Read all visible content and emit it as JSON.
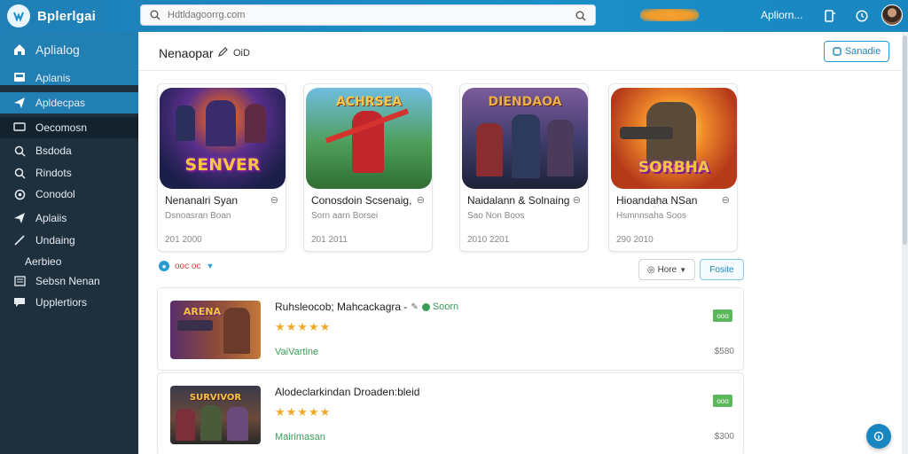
{
  "brand": {
    "name": "Bplerlgai"
  },
  "search": {
    "placeholder": "Hdtldagoorrg.com",
    "value": ""
  },
  "topbar": {
    "user_label": "Apliorn...",
    "colors": {
      "bar": "#1b8fc9",
      "accent": "#f09a2a"
    }
  },
  "sidebar": {
    "items": [
      {
        "label": "Aplialog",
        "icon": "home-icon"
      },
      {
        "label": "Aplanis",
        "icon": "inbox-icon"
      },
      {
        "label": "Apldecpas",
        "icon": "send-icon"
      },
      {
        "label": "Oecomosn",
        "icon": "chat-icon"
      },
      {
        "label": "Bsdoda",
        "icon": "search-icon"
      },
      {
        "label": "Rindots",
        "icon": "search-icon"
      },
      {
        "label": "Conodol",
        "icon": "settings-icon"
      },
      {
        "label": "Aplaiis",
        "icon": "send-icon"
      },
      {
        "label": "Undaing",
        "icon": "pen-icon"
      },
      {
        "label": "Aerbieo",
        "icon": ""
      },
      {
        "label": "Sebsn Nenan",
        "icon": "list-icon"
      },
      {
        "label": "Upplertiors",
        "icon": "comment-icon"
      }
    ]
  },
  "header": {
    "title": "Nenaopar",
    "subtitle": "OiD",
    "button_label": "Sanadie"
  },
  "cards": [
    {
      "title": "Nenanalri Syan",
      "subtitle": "Dsnoasran Boan",
      "meta": "201 2000",
      "art_text": "SENVER"
    },
    {
      "title": "Conosdoin Scsenaig,",
      "subtitle": "Sorn aarn Borsei",
      "meta": "201 2011",
      "art_text": "ACHRSEA"
    },
    {
      "title": "Naidalann & Solnaing",
      "subtitle": "Sao Non Boos",
      "meta": "2010 2201",
      "art_text": "DIENDAOA"
    },
    {
      "title": "Hioandaha NSan",
      "subtitle": "Hsmnnsaha Soos",
      "meta": "290 2010",
      "art_text": "SORBHA"
    }
  ],
  "filter": {
    "label": "ooc oc",
    "sort_label": "Hore",
    "filter_label": "Fosite"
  },
  "list": [
    {
      "title": "Ruhsleocob; Mahcackagra -",
      "badge": "Soorn",
      "rating": "★★★★★",
      "tag": "VaiVartine",
      "chip": "ooo",
      "price": "$580",
      "art_text": "ARENA"
    },
    {
      "title": "Alodeclarkindan Droaden:bleid",
      "badge": "",
      "rating": "★★★★★",
      "tag": "Mairimasan",
      "chip": "ooo",
      "price": "$300",
      "art_text": "SURVIVOR"
    }
  ]
}
